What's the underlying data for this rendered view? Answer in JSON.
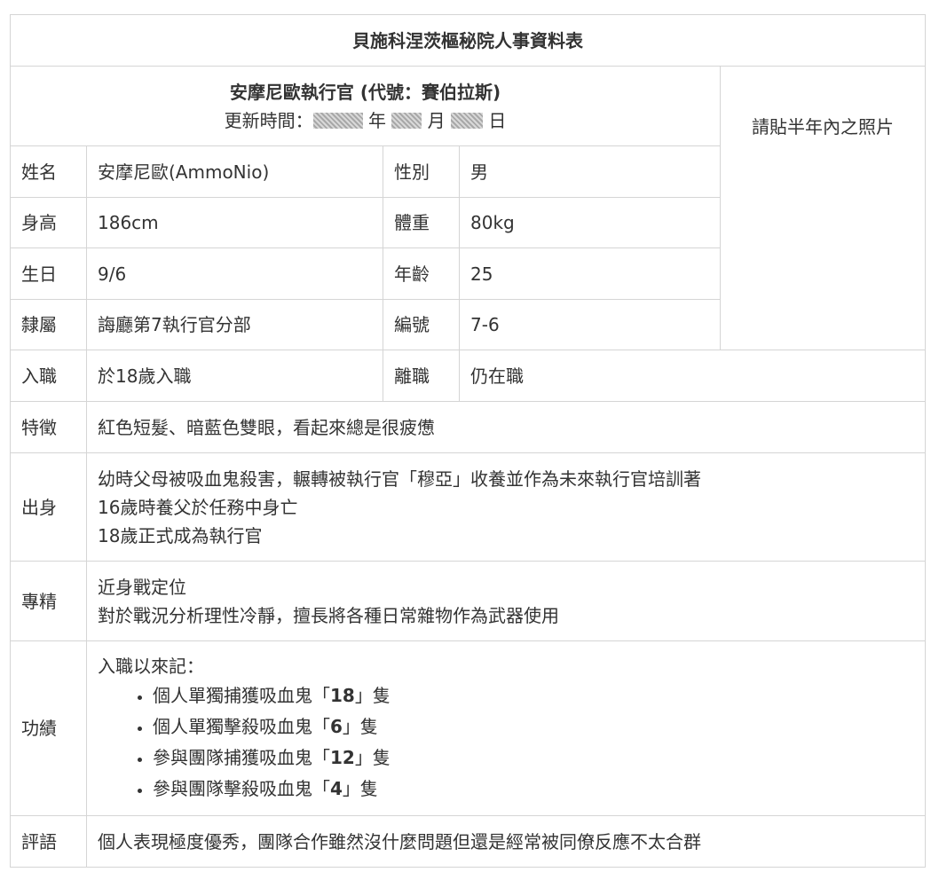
{
  "title": "貝施科涅茨樞秘院人事資料表",
  "header": {
    "name_line": "安摩尼歐執行官 (代號：賽伯拉斯)",
    "update_prefix": "更新時間：",
    "year_unit": "年",
    "month_unit": "月",
    "day_unit": "日"
  },
  "photo_placeholder": "請貼半年內之照片",
  "basic": {
    "name_label": "姓名",
    "name_value": "安摩尼歐(AmmoNio)",
    "gender_label": "性別",
    "gender_value": "男",
    "height_label": "身高",
    "height_value": "186cm",
    "weight_label": "體重",
    "weight_value": "80kg",
    "birthday_label": "生日",
    "birthday_value": "9/6",
    "age_label": "年齡",
    "age_value": "25",
    "affiliation_label": "隸屬",
    "affiliation_value": "誨廳第7執行官分部",
    "number_label": "編號",
    "number_value": "7-6",
    "join_label": "入職",
    "join_value": "於18歲入職",
    "leave_label": "離職",
    "leave_value": "仍在職"
  },
  "features": {
    "label": "特徵",
    "value": "紅色短髮、暗藍色雙眼，看起來總是很疲憊"
  },
  "origin": {
    "label": "出身",
    "lines": [
      "幼時父母被吸血鬼殺害，輾轉被執行官「穆亞」收養並作為未來執行官培訓著",
      "16歲時養父於任務中身亡",
      "18歲正式成為執行官"
    ]
  },
  "specialty": {
    "label": "專精",
    "lines": [
      "近身戰定位",
      "對於戰況分析理性冷靜，擅長將各種日常雜物作為武器使用"
    ]
  },
  "achievements": {
    "label": "功績",
    "intro": "入職以來記：",
    "items": [
      {
        "prefix": "個人單獨捕獲吸血鬼「",
        "count": "18",
        "suffix": "」隻"
      },
      {
        "prefix": "個人單獨擊殺吸血鬼「",
        "count": "6",
        "suffix": "」隻"
      },
      {
        "prefix": "參與團隊捕獲吸血鬼「",
        "count": "12",
        "suffix": "」隻"
      },
      {
        "prefix": "參與團隊擊殺吸血鬼「",
        "count": "4",
        "suffix": "」隻"
      }
    ]
  },
  "comment": {
    "label": "評語",
    "value": "個人表現極度優秀，團隊合作雖然沒什麼問題但還是經常被同僚反應不太合群"
  }
}
